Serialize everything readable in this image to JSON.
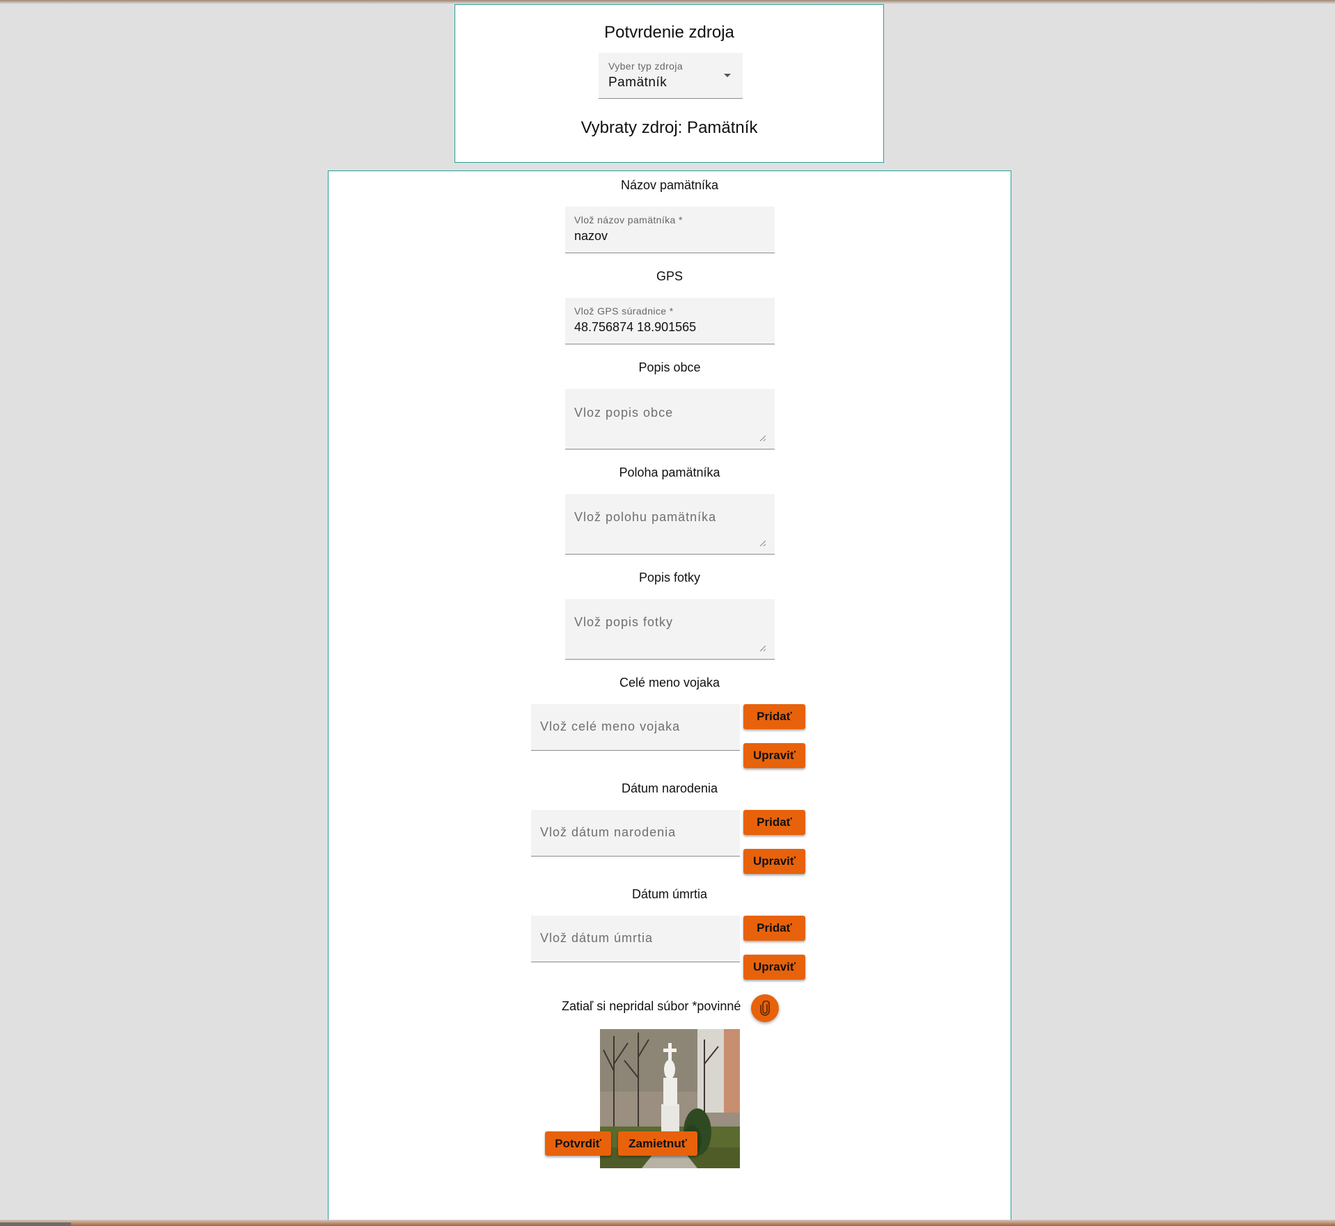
{
  "header": {
    "title": "Potvrdenie zdroja",
    "source_type_select": {
      "label": "Vyber typ zdroja",
      "value": "Pamätník"
    },
    "selected_text": "Vybraty zdroj: Pamätník"
  },
  "form": {
    "name_section": {
      "title": "Názov pamätníka",
      "input_label": "Vlož názov pamätníka *",
      "input_value": "nazov"
    },
    "gps_section": {
      "title": "GPS",
      "input_label": "Vlož GPS súradnice *",
      "input_value": "48.756874 18.901565"
    },
    "village_section": {
      "title": "Popis obce",
      "placeholder": "Vloz popis obce"
    },
    "location_section": {
      "title": "Poloha pamätníka",
      "placeholder": "Vlož polohu pamätníka"
    },
    "photo_desc_section": {
      "title": "Popis fotky",
      "placeholder": "Vlož popis fotky"
    },
    "soldier_name_section": {
      "title": "Celé meno vojaka",
      "placeholder": "Vlož celé meno vojaka",
      "add_label": "Pridať",
      "edit_label": "Upraviť"
    },
    "birth_date_section": {
      "title": "Dátum narodenia",
      "placeholder": "Vlož dátum narodenia",
      "add_label": "Pridať",
      "edit_label": "Upraviť"
    },
    "death_date_section": {
      "title": "Dátum úmrtia",
      "placeholder": "Vlož dátum úmrtia",
      "add_label": "Pridať",
      "edit_label": "Upraviť"
    },
    "file": {
      "status": "Zatiaľ si nepridal súbor *povinné",
      "attach_icon": "paperclip-icon"
    },
    "actions": {
      "confirm_label": "Potvrdiť",
      "reject_label": "Zamietnuť"
    }
  },
  "colors": {
    "accent": "#e8620b",
    "card_border": "#2a9d9a",
    "background": "#e0e0e0"
  }
}
